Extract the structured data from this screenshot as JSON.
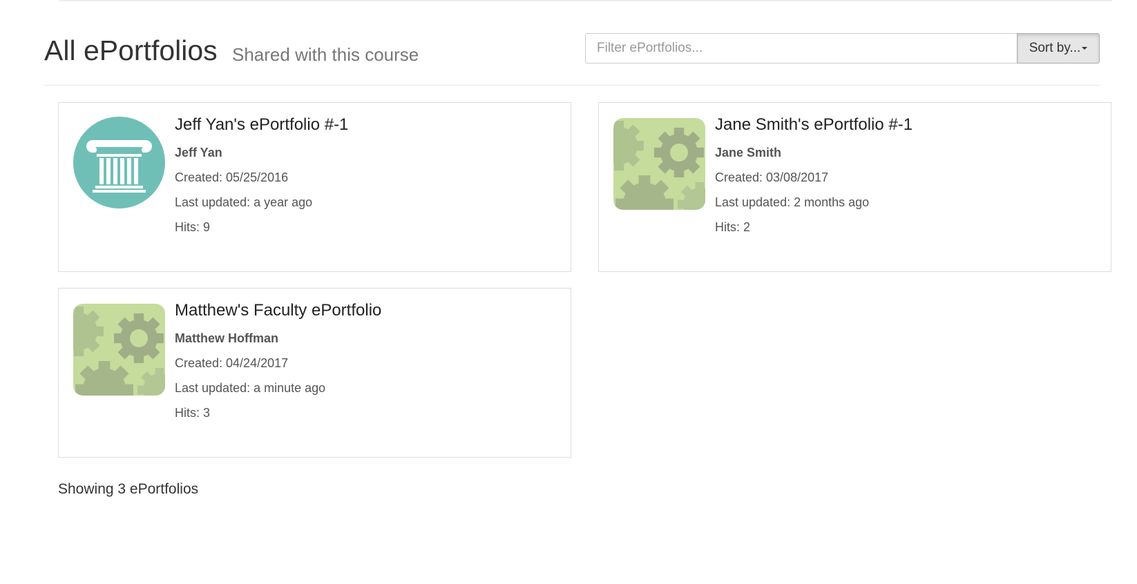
{
  "header": {
    "title": "All ePortfolios",
    "subtitle": "Shared with this course",
    "filter_placeholder": "Filter ePortfolios...",
    "sort_label": "Sort by..."
  },
  "portfolios": [
    {
      "title": "Jeff Yan's ePortfolio #-1",
      "owner": "Jeff Yan",
      "created": "Created: 05/25/2016",
      "updated": "Last updated: a year ago",
      "hits": "Hits: 9",
      "thumbnail": "pillar-icon"
    },
    {
      "title": "Jane Smith's ePortfolio #-1",
      "owner": "Jane Smith",
      "created": "Created: 03/08/2017",
      "updated": "Last updated: 2 months ago",
      "hits": "Hits: 2",
      "thumbnail": "gears-icon"
    },
    {
      "title": "Matthew's Faculty ePortfolio",
      "owner": "Matthew Hoffman",
      "created": "Created: 04/24/2017",
      "updated": "Last updated: a minute ago",
      "hits": "Hits: 3",
      "thumbnail": "gears-icon"
    }
  ],
  "footer": {
    "count_text": "Showing 3 ePortfolios"
  },
  "colors": {
    "pillar_bg": "#6fbfb7",
    "gear_bg": "#c7dd9e"
  }
}
